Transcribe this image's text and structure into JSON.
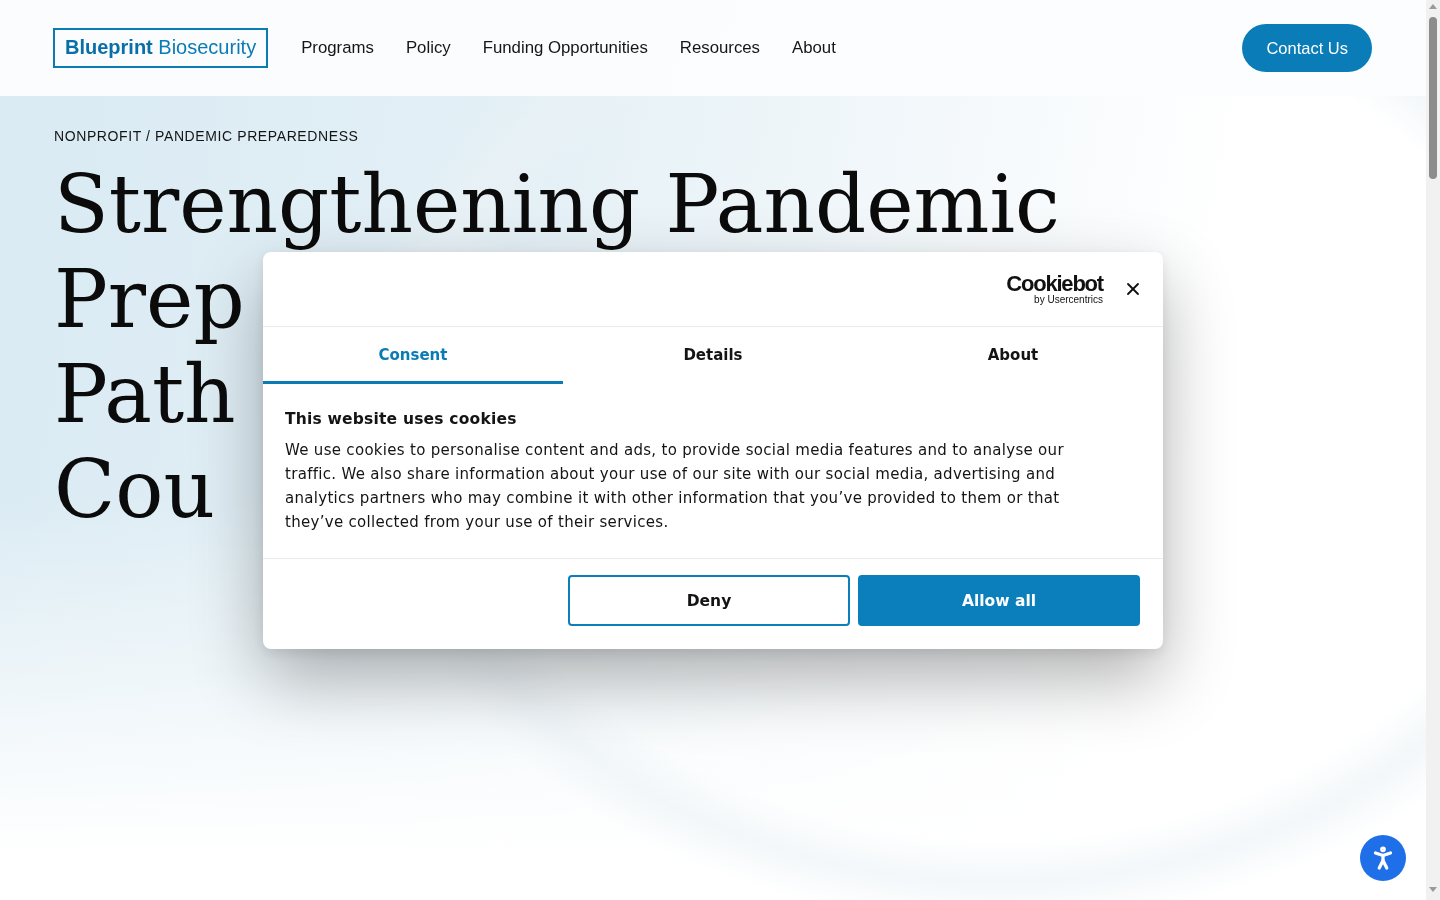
{
  "header": {
    "logo": "**Blueprint** Biosecurity",
    "nav": [
      "Programs",
      "Policy",
      "Funding Opportunities",
      "Resources",
      "About"
    ],
    "contact_button": "Contact Us"
  },
  "hero": {
    "eyebrow": "NONPROFIT / PANDEMIC PREPAREDNESS",
    "heading_lines": [
      "Strengthening Pandemic",
      "Prep",
      "Path",
      "Cou"
    ]
  },
  "cookie_dialog": {
    "brand": "Cookiebot",
    "brand_byline": "by Usercentrics",
    "tabs": [
      {
        "label": "Consent",
        "selected": true
      },
      {
        "label": "Details",
        "selected": false
      },
      {
        "label": "About",
        "selected": false
      }
    ],
    "title": "This website uses cookies",
    "body": "We use cookies to personalise content and ads, to provide social media features and to analyse our traffic. We also share information about your use of our site with our social media, advertising and analytics partners who may combine it with other information that you’ve provided to them or that they’ve collected from your use of their services.",
    "buttons": [
      {
        "label": "Deny",
        "kind": "outline"
      },
      {
        "label": "Allow all",
        "kind": "primary"
      }
    ]
  }
}
